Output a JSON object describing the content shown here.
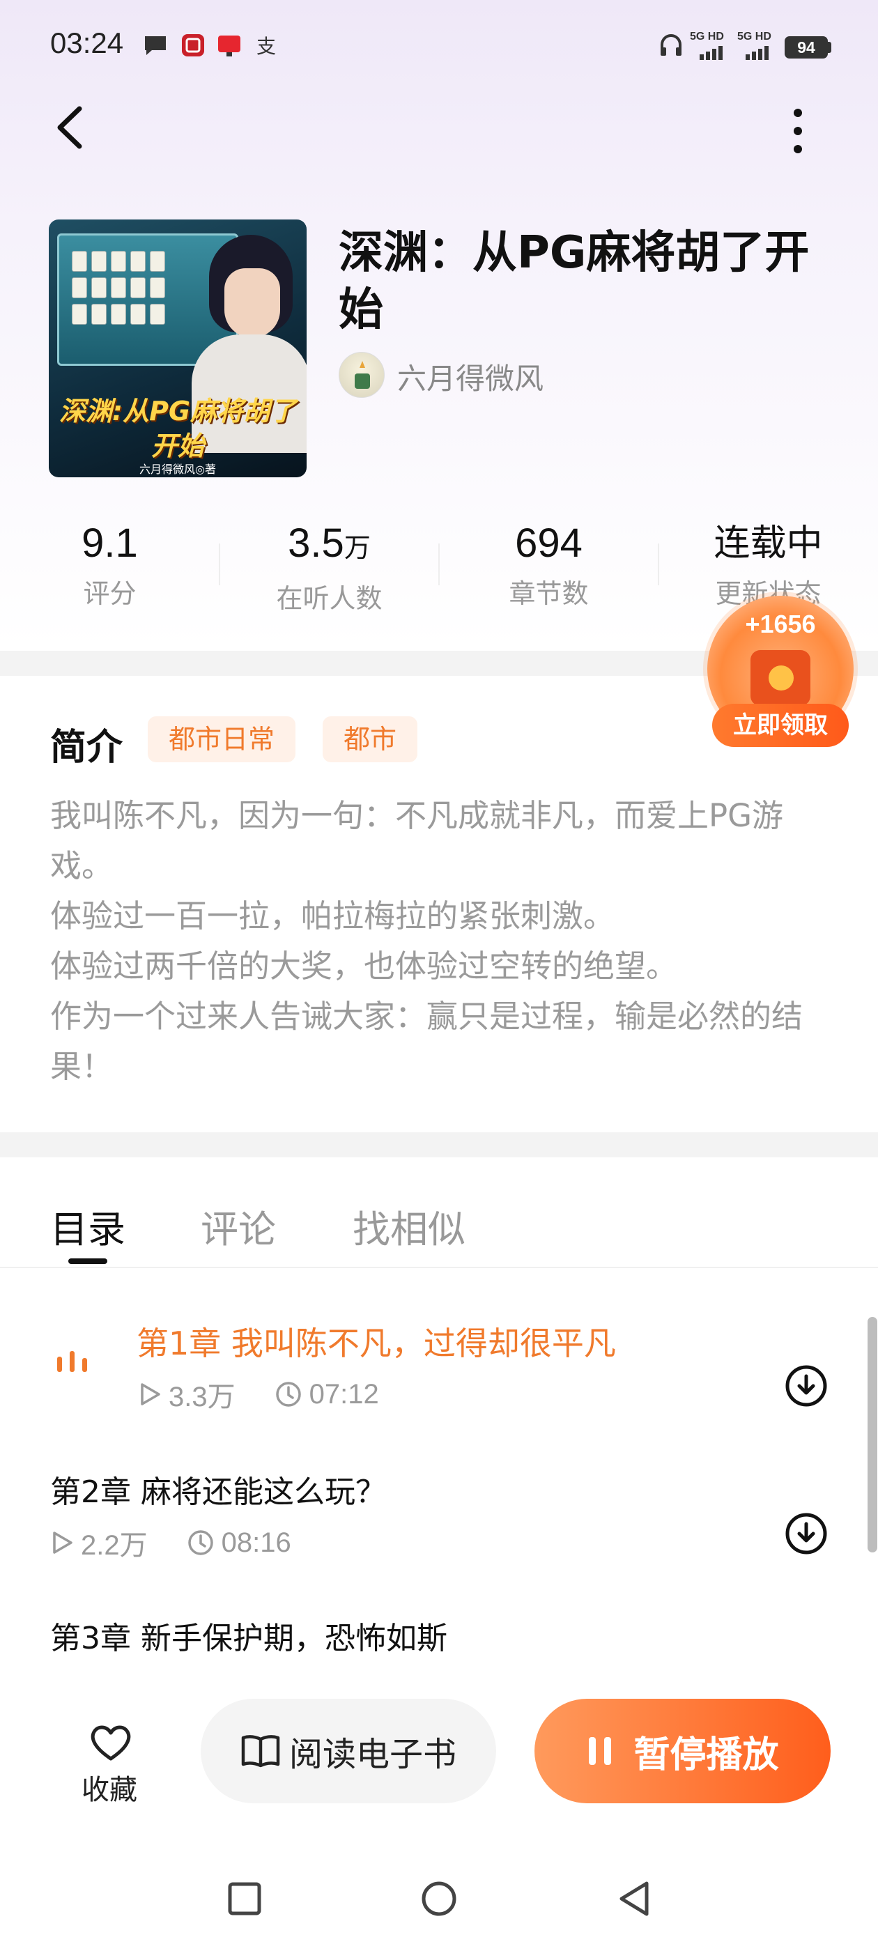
{
  "status_bar": {
    "time": "03:24",
    "net1": "5G HD",
    "net2": "5G HD",
    "battery": "94"
  },
  "book": {
    "title": "深渊：从PG麻将胡了开始",
    "author": "六月得微风",
    "cover_title": "深渊:从PG麻将胡了开始",
    "cover_author": "六月得微风◎著"
  },
  "stats": [
    {
      "value": "9.1",
      "unit": "",
      "label": "评分"
    },
    {
      "value": "3.5",
      "unit": "万",
      "label": "在听人数"
    },
    {
      "value": "694",
      "unit": "",
      "label": "章节数"
    },
    {
      "value": "连载中",
      "unit": "",
      "label": "更新状态"
    }
  ],
  "reward": {
    "amount": "+1656",
    "button": "立即领取"
  },
  "intro": {
    "heading": "简介",
    "tags": [
      "都市日常",
      "都市"
    ],
    "text": "我叫陈不凡，因为一句：不凡成就非凡，而爱上PG游戏。\n体验过一百一拉，帕拉梅拉的紧张刺激。\n体验过两千倍的大奖，也体验过空转的绝望。\n作为一个过来人告诫大家：赢只是过程，输是必然的结果！"
  },
  "tabs": [
    "目录",
    "评论",
    "找相似"
  ],
  "chapters": [
    {
      "title": "第1章 我叫陈不凡，过得却很平凡",
      "plays": "3.3万",
      "duration": "07:12",
      "playing": true
    },
    {
      "title": "第2章 麻将还能这么玩？",
      "plays": "2.2万",
      "duration": "08:16",
      "playing": false
    },
    {
      "title": "第3章 新手保护期，恐怖如斯",
      "plays": "",
      "duration": "",
      "playing": false
    }
  ],
  "bottom": {
    "favorite": "收藏",
    "read_ebook": "阅读电子书",
    "pause": "暂停播放"
  },
  "icons": {
    "accent": "#f07a2c",
    "status": [
      "message-icon",
      "app-icon",
      "notification-icon",
      "alipay-icon",
      "headphone-icon"
    ]
  }
}
